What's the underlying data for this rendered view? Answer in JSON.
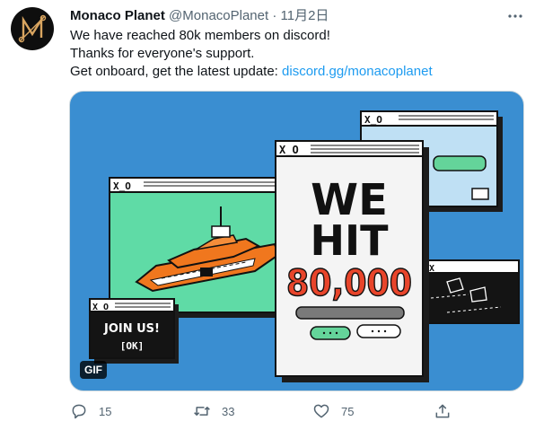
{
  "tweet": {
    "author_name": "Monaco Planet",
    "handle": "@MonacoPlanet",
    "separator": "·",
    "time": "11月2日",
    "lines": [
      "We have reached 80k members on discord!",
      "Thanks for everyone's support."
    ],
    "line3_prefix": "Get onboard, get the latest update: ",
    "link": "discord.gg/monacoplanet"
  },
  "media": {
    "badge": "GIF",
    "headline_line1": "WE",
    "headline_line2": "HIT",
    "count_text": "80,000",
    "join_text": "JOIN US!",
    "ok_text": "[OK]"
  },
  "actions": {
    "reply_count": "15",
    "retweet_count": "33",
    "like_count": "75"
  },
  "icons": {
    "avatar": "monaco-planet-logo",
    "more": "more-icon",
    "reply": "reply-icon",
    "retweet": "retweet-icon",
    "like": "heart-icon",
    "share": "share-icon"
  },
  "colors": {
    "link": "#1d9bf0",
    "muted": "#536471",
    "media_background": "#3a8ed1",
    "yacht_panel": "#5fdba6",
    "yacht_hull": "#f0771e"
  }
}
